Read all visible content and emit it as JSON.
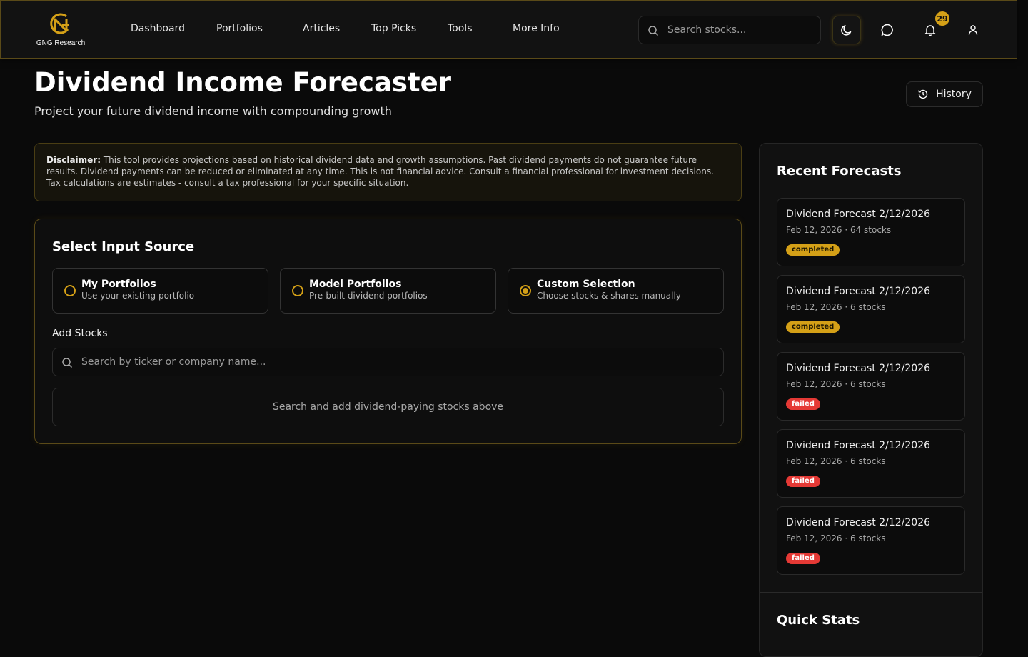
{
  "brand": {
    "name": "GNG Research",
    "accent": "#d4a017"
  },
  "nav": [
    {
      "label": "Dashboard"
    },
    {
      "label": "Portfolios"
    },
    {
      "label": "Articles"
    },
    {
      "label": "Top Picks"
    },
    {
      "label": "Tools"
    },
    {
      "label": "More Info"
    }
  ],
  "header": {
    "search_placeholder": "Search stocks...",
    "notification_count": "29",
    "icons": [
      "search-icon",
      "moon-icon",
      "chat-icon",
      "bell-icon",
      "user-icon"
    ]
  },
  "page": {
    "title": "Dividend Income Forecaster",
    "subtitle": "Project your future dividend income with compounding growth",
    "history_label": "History"
  },
  "disclaimer": {
    "label": "Disclaimer:",
    "text": "This tool provides projections based on historical dividend data and growth assumptions. Past dividend payments do not guarantee future results. Dividend payments can be reduced or eliminated at any time. This is not financial advice. Consult a financial professional for investment decisions. Tax calculations are estimates - consult a tax professional for your specific situation."
  },
  "input_source": {
    "title": "Select Input Source",
    "options": [
      {
        "title": "My Portfolios",
        "desc": "Use your existing portfolio",
        "selected": false
      },
      {
        "title": "Model Portfolios",
        "desc": "Pre-built dividend portfolios",
        "selected": false
      },
      {
        "title": "Custom Selection",
        "desc": "Choose stocks & shares manually",
        "selected": true
      }
    ],
    "add_stocks_label": "Add Stocks",
    "stock_search_placeholder": "Search by ticker or company name...",
    "empty_text": "Search and add dividend-paying stocks above"
  },
  "recent": {
    "title": "Recent Forecasts",
    "items": [
      {
        "name": "Dividend Forecast 2/12/2026",
        "meta": "Feb 12, 2026 · 64 stocks",
        "status": "completed"
      },
      {
        "name": "Dividend Forecast 2/12/2026",
        "meta": "Feb 12, 2026 · 6 stocks",
        "status": "completed"
      },
      {
        "name": "Dividend Forecast 2/12/2026",
        "meta": "Feb 12, 2026 · 6 stocks",
        "status": "failed"
      },
      {
        "name": "Dividend Forecast 2/12/2026",
        "meta": "Feb 12, 2026 · 6 stocks",
        "status": "failed"
      },
      {
        "name": "Dividend Forecast 2/12/2026",
        "meta": "Feb 12, 2026 · 6 stocks",
        "status": "failed"
      }
    ]
  },
  "quick_stats": {
    "title": "Quick Stats"
  }
}
